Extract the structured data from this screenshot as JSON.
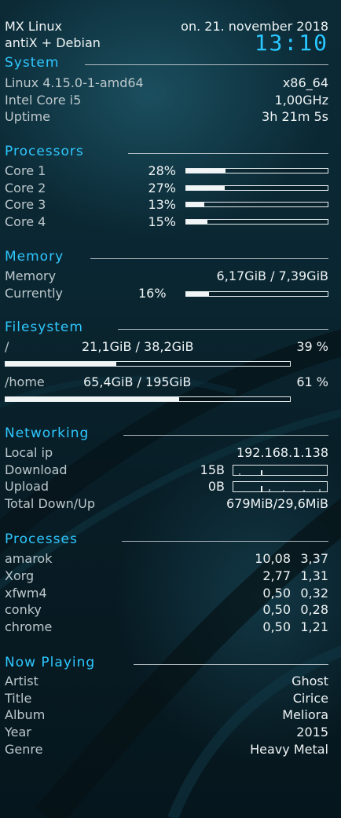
{
  "header": {
    "distro": "MX Linux",
    "base": "antiX + Debian",
    "date": "on. 21. november 2018",
    "time": "13:10"
  },
  "system": {
    "heading": "System",
    "rows": [
      {
        "label": "Linux 4.15.0-1-amd64",
        "value": "x86_64"
      },
      {
        "label": "Intel Core i5",
        "value": "1,00GHz"
      },
      {
        "label": "Uptime",
        "value": "3h 21m 5s"
      }
    ]
  },
  "processors": {
    "heading": "Processors",
    "cores": [
      {
        "label": "Core 1",
        "pct": "28%",
        "level": 0.28
      },
      {
        "label": "Core 2",
        "pct": "27%",
        "level": 0.27
      },
      {
        "label": "Core 3",
        "pct": "13%",
        "level": 0.13
      },
      {
        "label": "Core 4",
        "pct": "15%",
        "level": 0.15
      }
    ]
  },
  "memory": {
    "heading": "Memory",
    "label": "Memory",
    "value": "6,17GiB / 7,39GiB",
    "current_label": "Currently",
    "current_pct": "16%",
    "current_level": 0.16
  },
  "filesystem": {
    "heading": "Filesystem",
    "mounts": [
      {
        "path": "/",
        "usage": "21,1GiB / 38,2GiB",
        "pct": "39 %",
        "level": 0.39
      },
      {
        "path": "/home",
        "usage": "65,4GiB / 195GiB",
        "pct": "61 %",
        "level": 0.61
      }
    ]
  },
  "networking": {
    "heading": "Networking",
    "local_ip_label": "Local ip",
    "local_ip": "192.168.1.138",
    "download_label": "Download",
    "download": "15B",
    "upload_label": "Upload",
    "upload": "0B",
    "total_label": "Total Down/Up",
    "total": "679MiB/29,6MiB"
  },
  "processes": {
    "heading": "Processes",
    "rows": [
      {
        "name": "amarok",
        "a": "10,08",
        "b": "3,37"
      },
      {
        "name": "Xorg",
        "a": "2,77",
        "b": "1,31"
      },
      {
        "name": "xfwm4",
        "a": "0,50",
        "b": "0,32"
      },
      {
        "name": "conky",
        "a": "0,50",
        "b": "0,28"
      },
      {
        "name": "chrome",
        "a": "0,50",
        "b": "1,21"
      }
    ]
  },
  "now_playing": {
    "heading": "Now Playing",
    "rows": [
      {
        "label": "Artist",
        "value": "Ghost"
      },
      {
        "label": "Title",
        "value": "Cirice"
      },
      {
        "label": "Album",
        "value": "Meliora"
      },
      {
        "label": "Year",
        "value": "2015"
      },
      {
        "label": "Genre",
        "value": "Heavy Metal"
      }
    ]
  },
  "colors": {
    "accent": "#2fc7ff",
    "text": "#eef3f4",
    "dim_text": "#bdc8cc",
    "background": "#0a2631"
  }
}
